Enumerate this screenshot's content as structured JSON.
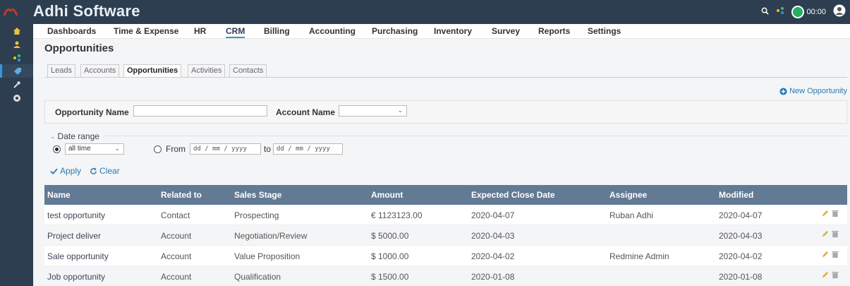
{
  "app": {
    "title": "Adhi Software",
    "timer": "00:00"
  },
  "mainmenu": [
    "Dashboards",
    "Time & Expense",
    "HR",
    "CRM",
    "Billing",
    "Accounting",
    "Purchasing",
    "Inventory",
    "Survey",
    "Reports",
    "Settings"
  ],
  "page": {
    "title": "Opportunities"
  },
  "subtabs": [
    "Leads",
    "Accounts",
    "Opportunities",
    "Activities",
    "Contacts"
  ],
  "new_button": "New Opportunity",
  "filters": {
    "opportunity_name_label": "Opportunity Name",
    "opportunity_name_value": "",
    "account_name_label": "Account Name",
    "account_name_value": ""
  },
  "daterange": {
    "legend": "Date range",
    "period_value": "all time",
    "from_label": "From",
    "to_label": "to",
    "from_placeholder": "dd / mm / yyyy",
    "to_placeholder": "dd / mm / yyyy"
  },
  "actions": {
    "apply": "Apply",
    "clear": "Clear"
  },
  "colors": {
    "header": "#637a94",
    "link": "#2a7ab0",
    "sidebar": "#2c3e50",
    "accent": "#3498db"
  },
  "table": {
    "columns": [
      "Name",
      "Related to",
      "Sales Stage",
      "Amount",
      "Expected Close Date",
      "Assignee",
      "Modified"
    ],
    "rows": [
      [
        "test opportunity",
        "Contact",
        "Prospecting",
        "€ 1123123.00",
        "2020-04-07",
        "Ruban Adhi",
        "2020-04-07"
      ],
      [
        "Project deliver",
        "Account",
        "Negotiation/Review",
        "$ 5000.00",
        "2020-04-03",
        "",
        "2020-04-03"
      ],
      [
        "Sale opportunity",
        "Account",
        "Value Proposition",
        "$ 1000.00",
        "2020-04-02",
        "Redmine Admin",
        "2020-04-02"
      ],
      [
        "Job opportunity",
        "Account",
        "Qualification",
        "$ 1500.00",
        "2020-01-08",
        "",
        "2020-01-08"
      ]
    ]
  }
}
